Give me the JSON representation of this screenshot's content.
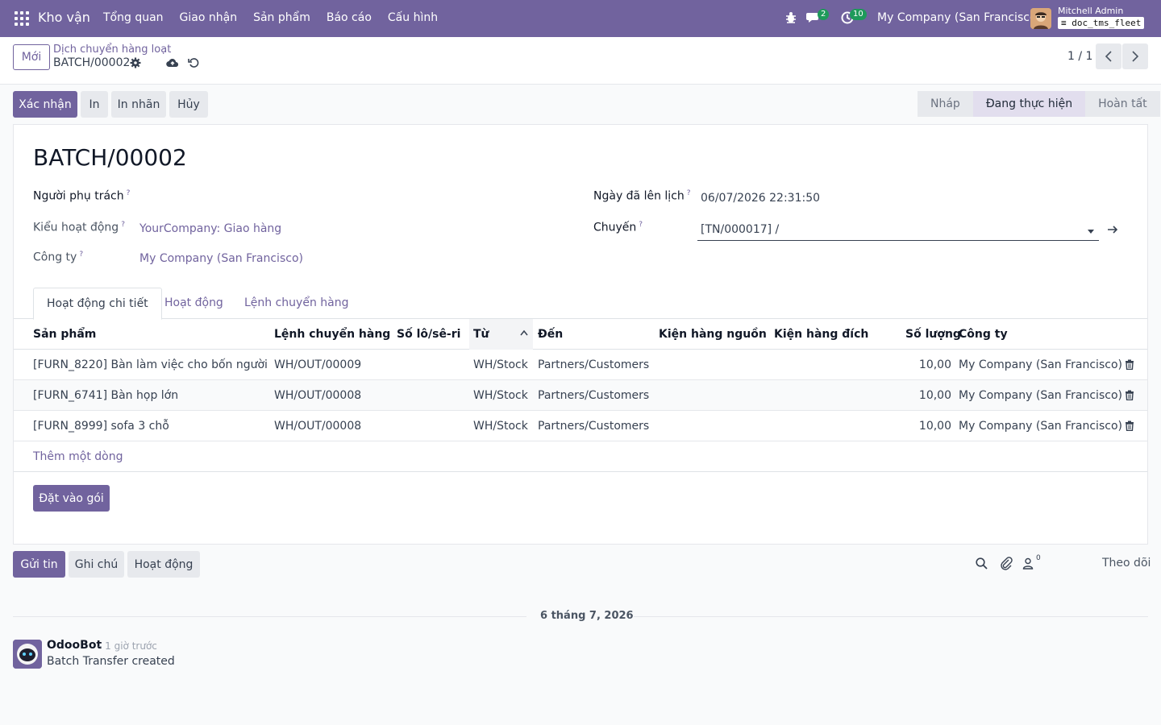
{
  "navbar": {
    "brand": "Kho vận",
    "menu": [
      "Tổng quan",
      "Giao nhận",
      "Sản phẩm",
      "Báo cáo",
      "Cấu hình"
    ],
    "chat_count": "2",
    "activity_count": "10",
    "company": "My Company (San Francisco)",
    "user": "Mitchell Admin",
    "database": "doc_tms_fleet"
  },
  "control": {
    "new_label": "Mới",
    "breadcrumb_parent": "Dịch chuyển hàng loạt",
    "breadcrumb_current": "BATCH/00002",
    "pager": "1 / 1"
  },
  "actions": {
    "confirm": "Xác nhận",
    "print": "In",
    "print_labels": "In nhãn",
    "cancel": "Hủy"
  },
  "status": {
    "stages": [
      "Nháp",
      "Đang thực hiện",
      "Hoàn tất"
    ],
    "active": 1
  },
  "form": {
    "title": "BATCH/00002",
    "responsible_label": "Người phụ trách",
    "operation_type_label": "Kiểu hoạt động",
    "operation_type": "YourCompany: Giao hàng",
    "company_label": "Công ty",
    "company": "My Company (San Francisco)",
    "scheduled_date_label": "Ngày đã lên lịch",
    "scheduled_date": "06/07/2026 22:31:50",
    "trip_label": "Chuyến",
    "trip": "[TN/000017] /",
    "help_mark": "?"
  },
  "tabs": [
    "Hoạt động chi tiết",
    "Hoạt động",
    "Lệnh chuyển hàng"
  ],
  "table": {
    "headers": [
      "Sản phẩm",
      "Lệnh chuyển hàng",
      "Số lô/sê-ri",
      "Từ",
      "Đến",
      "Kiện hàng nguồn",
      "Kiện hàng đích",
      "Số lượng",
      "Công ty"
    ],
    "rows": [
      {
        "product": "[FURN_8220] Bàn làm việc cho bốn người",
        "transfer": "WH/OUT/00009",
        "lot": "",
        "from": "WH/Stock",
        "to": "Partners/Customers",
        "src_pkg": "",
        "dst_pkg": "",
        "qty": "10,00",
        "company": "My Company (San Francisco)"
      },
      {
        "product": "[FURN_6741] Bàn họp lớn",
        "transfer": "WH/OUT/00008",
        "lot": "",
        "from": "WH/Stock",
        "to": "Partners/Customers",
        "src_pkg": "",
        "dst_pkg": "",
        "qty": "10,00",
        "company": "My Company (San Francisco)"
      },
      {
        "product": "[FURN_8999] sofa 3 chỗ",
        "transfer": "WH/OUT/00008",
        "lot": "",
        "from": "WH/Stock",
        "to": "Partners/Customers",
        "src_pkg": "",
        "dst_pkg": "",
        "qty": "10,00",
        "company": "My Company (San Francisco)"
      }
    ],
    "add_line": "Thêm một dòng"
  },
  "put_in_pack": "Đặt vào gói",
  "chatter": {
    "send_message": "Gửi tin",
    "log_note": "Ghi chú",
    "activities": "Hoạt động",
    "followers_count": "0",
    "follow": "Theo dõi",
    "date_separator": "6 tháng 7, 2026",
    "message": {
      "author": "OdooBot",
      "time": "- 1 giờ trước",
      "body": "Batch Transfer created"
    }
  },
  "colors": {
    "brand": "#71639e",
    "badge": "#1e9a5a"
  }
}
